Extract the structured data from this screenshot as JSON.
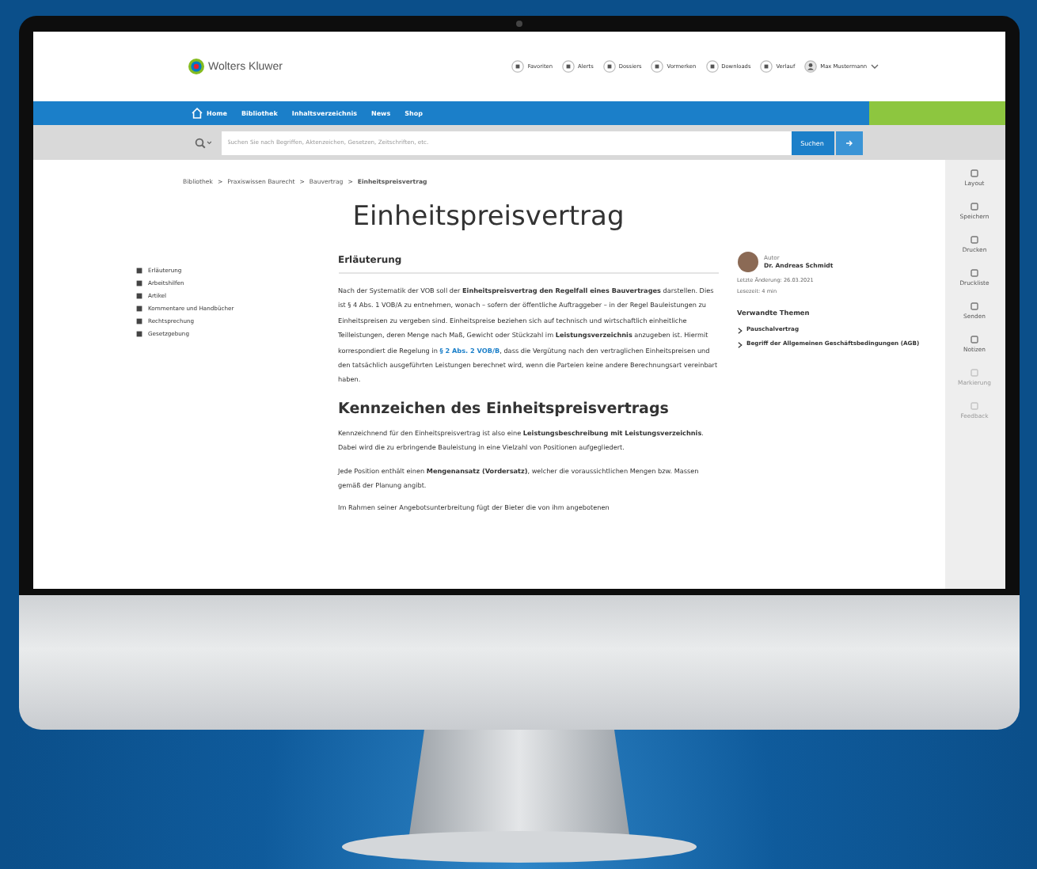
{
  "header": {
    "logo": "Wolters Kluwer",
    "actions": [
      {
        "label": "Favoriten"
      },
      {
        "label": "Alerts"
      },
      {
        "label": "Dossiers"
      },
      {
        "label": "Vormerken"
      },
      {
        "label": "Downloads"
      },
      {
        "label": "Verlauf"
      },
      {
        "label": "Max Mustermann",
        "kind": "user"
      }
    ]
  },
  "nav": {
    "home": "Home",
    "items": [
      "Bibliothek",
      "Inhaltsverzeichnis",
      "News",
      "Shop"
    ]
  },
  "search": {
    "placeholder": "Suchen Sie nach Begriffen, Aktenzeichen, Gesetzen, Zeitschriften, etc.",
    "button": "Suchen"
  },
  "breadcrumb": {
    "separator": ">",
    "items": [
      "Bibliothek",
      "Praxiswissen Baurecht",
      "Bauvertrag",
      "Einheitspreisvertrag"
    ]
  },
  "title": "Einheitspreisvertrag",
  "toc": [
    {
      "label": "Erläuterung"
    },
    {
      "label": "Arbeitshilfen"
    },
    {
      "label": "Artikel"
    },
    {
      "label": "Kommentare und Handbücher"
    },
    {
      "label": "Rechtsprechung"
    },
    {
      "label": "Gesetzgebung"
    }
  ],
  "sections": [
    {
      "kind": "subheading",
      "heading": "Erläuterung",
      "paragraphs": [
        [
          {
            "kind": "text",
            "text": "Nach der Systematik der VOB soll der **Einheitspreisvertrag den Regelfall eines Bauvertrages** darstellen. Dies ist § 4 Abs. 1 VOB/A zu entnehmen, wonach – sofern der öffentliche Auftraggeber – in der Regel Bauleistungen zu Einheitspreisen zu vergeben sind. Einheitspreise beziehen sich auf technisch und wirtschaftlich einheitliche Teilleistungen, deren Menge nach Maß, Gewicht oder Stückzahl im **Leistungsverzeichnis** anzugeben ist. Hiermit korrespondiert die Regelung in "
          },
          {
            "kind": "link",
            "text": "§ 2 Abs. 2 VOB/B"
          },
          {
            "kind": "text",
            "text": ", dass die Vergütung nach den vertraglichen Einheitspreisen und den tatsächlich ausgeführten Leistungen berechnet wird, wenn die Parteien keine andere Berechnungsart vereinbart haben."
          }
        ]
      ]
    },
    {
      "kind": "heading",
      "heading": "Kennzeichen des Einheitspreisvertrags",
      "paragraphs": [
        [
          {
            "kind": "text",
            "text": "Kennzeichnend für den Einheitspreisvertrag ist also eine **Leistungsbeschreibung mit Leistungsverzeichnis**. Dabei wird die zu erbringende Bauleistung in eine Vielzahl von Positionen aufgegliedert."
          }
        ],
        [
          {
            "kind": "text",
            "text": "Jede Position enthält einen **Mengenansatz (Vordersatz)**, welcher die voraussichtlichen Mengen bzw. Massen gemäß der Planung angibt."
          }
        ],
        [
          {
            "kind": "text",
            "text": "Im Rahmen seiner Angebotsunterbreitung fügt der Bieter die von ihm angebotenen"
          }
        ]
      ]
    }
  ],
  "author": {
    "role": "Autor",
    "name": "Dr. Andreas Schmidt",
    "updated": "Letzte Änderung: 26.03.2021",
    "reading_time": "Lesezeit: 4 min"
  },
  "related": {
    "title": "Verwandte Themen",
    "items": [
      "Pauschalvertrag",
      "Begriff der Allgemeinen Geschäftsbedingungen (AGB)"
    ]
  },
  "tools": [
    {
      "label": "Layout",
      "disabled": false
    },
    {
      "label": "Speichern",
      "disabled": false
    },
    {
      "label": "Drucken",
      "disabled": false
    },
    {
      "label": "Druckliste",
      "disabled": false
    },
    {
      "label": "Senden",
      "disabled": false
    },
    {
      "label": "Notizen",
      "disabled": false
    },
    {
      "label": "Markierung",
      "disabled": true
    },
    {
      "label": "Feedback",
      "disabled": true
    }
  ]
}
